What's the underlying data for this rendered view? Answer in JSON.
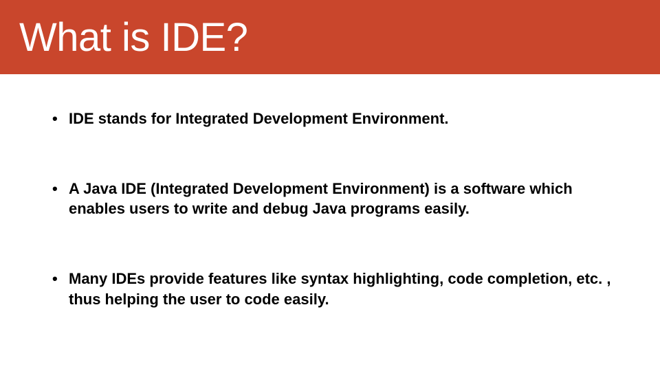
{
  "header": {
    "title": "What is IDE?"
  },
  "bullets": [
    "IDE  stands for Integrated Development Environment.",
    "A Java IDE (Integrated Development Environment) is a software which enables users to write and debug Java programs easily.",
    "Many IDEs provide features like syntax highlighting, code completion, etc. , thus helping the user to code easily."
  ]
}
